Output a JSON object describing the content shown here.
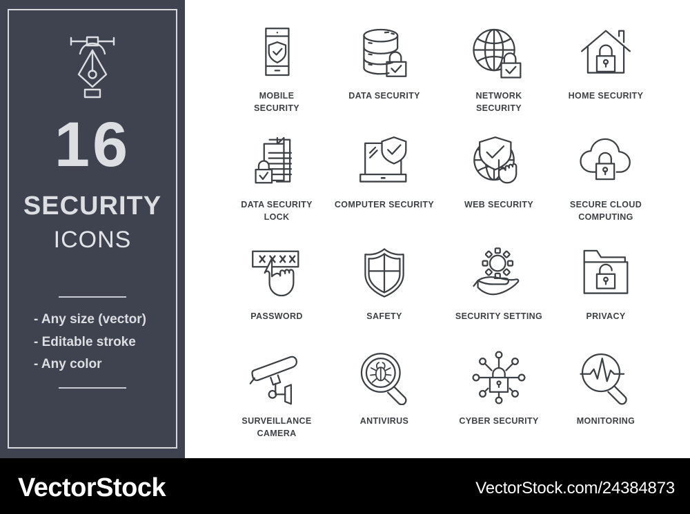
{
  "sidebar": {
    "logo_icon": "pen-tool-icon",
    "count": "16",
    "title": "SECURITY",
    "subtitle": "ICONS",
    "features": [
      "- Any size (vector)",
      "- Editable stroke",
      "- Any color"
    ],
    "background_color": "#3f434f",
    "text_color": "#dcdee1"
  },
  "icons": [
    {
      "label": "MOBILE\nSECURITY",
      "icon": "mobile-security-icon"
    },
    {
      "label": "DATA SECURITY",
      "icon": "data-security-icon"
    },
    {
      "label": "NETWORK\nSECURITY",
      "icon": "network-security-icon"
    },
    {
      "label": "HOME  SECURITY",
      "icon": "home-security-icon"
    },
    {
      "label": "DATA SECURITY\nLOCK",
      "icon": "data-security-lock-icon"
    },
    {
      "label": "COMPUTER SECURITY",
      "icon": "computer-security-icon"
    },
    {
      "label": "WEB SECURITY",
      "icon": "web-security-icon"
    },
    {
      "label": "SECURE CLOUD\nCOMPUTING",
      "icon": "secure-cloud-computing-icon"
    },
    {
      "label": "PASSWORD",
      "icon": "password-icon"
    },
    {
      "label": "SAFETY",
      "icon": "safety-shield-icon"
    },
    {
      "label": "SECURITY SETTING",
      "icon": "security-setting-icon"
    },
    {
      "label": "PRIVACY",
      "icon": "privacy-folder-icon"
    },
    {
      "label": "SURVEILLANCE\nCAMERA",
      "icon": "surveillance-camera-icon"
    },
    {
      "label": "ANTIVIRUS",
      "icon": "antivirus-icon"
    },
    {
      "label": "CYBER SECURITY",
      "icon": "cyber-security-icon"
    },
    {
      "label": "MONITORING",
      "icon": "monitoring-icon"
    }
  ],
  "icon_stroke_color": "#3d4044",
  "watermark": {
    "brand": "VectorStock",
    "url": "VectorStock.com/24384873",
    "background_color": "#000000",
    "text_color": "#ffffff"
  }
}
